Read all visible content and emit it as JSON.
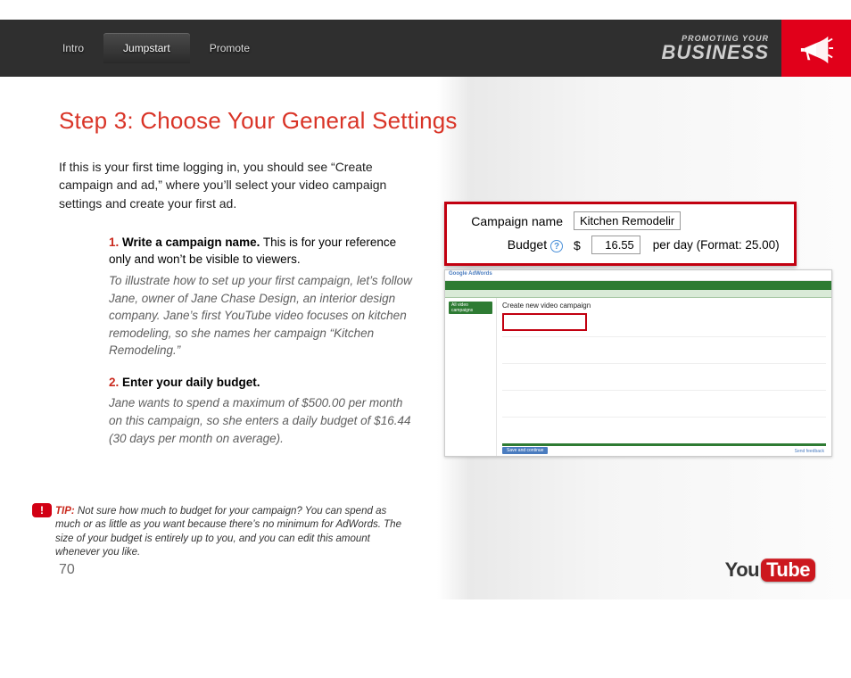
{
  "header": {
    "tabs": [
      "Intro",
      "Jumpstart",
      "Promote"
    ],
    "active_tab": 1,
    "brand_top": "Promoting Your",
    "brand_bottom": "Business"
  },
  "page": {
    "title": "Step 3: Choose Your General Settings",
    "intro": "If this is your first time logging in, you should see “Create campaign and ad,” where you’ll select your video campaign settings and create your first ad.",
    "steps": [
      {
        "num": "1.",
        "head": "Write a campaign name.",
        "body": " This is for your reference only and won’t be visible to viewers.",
        "italic": "To illustrate how to set up your first campaign, let’s follow Jane, owner of Jane Chase Design, an interior design company. Jane’s first YouTube video focuses on kitchen remodeling, so she names her campaign “Kitchen Remodeling.”"
      },
      {
        "num": "2.",
        "head": "Enter your daily budget.",
        "body": "",
        "italic": "Jane wants to spend a maximum of $500.00 per month on this campaign, so she enters a daily budget of $16.44 (30 days per month on average)."
      }
    ],
    "tip_lead": "TIP:",
    "tip": " Not sure how much to budget for your campaign? You can spend as much or as little as you want because there’s no minimum for AdWords. The size of your budget is entirely up to you, and you can edit this amount whenever you like.",
    "page_number": "70"
  },
  "callout": {
    "label_campaign": "Campaign name",
    "value_campaign": "Kitchen Remodeling",
    "label_budget": "Budget",
    "currency": "$",
    "value_budget": "16.55",
    "per_day": "per day (Format: 25.00)"
  },
  "adwords": {
    "logo": "Google AdWords",
    "main_title": "Create new video campaign",
    "sidebar_tag": "All video campaigns",
    "save_btn": "Save and continue",
    "send_feedback": "Send feedback"
  },
  "youtube": {
    "you": "You",
    "tube": "Tube"
  }
}
